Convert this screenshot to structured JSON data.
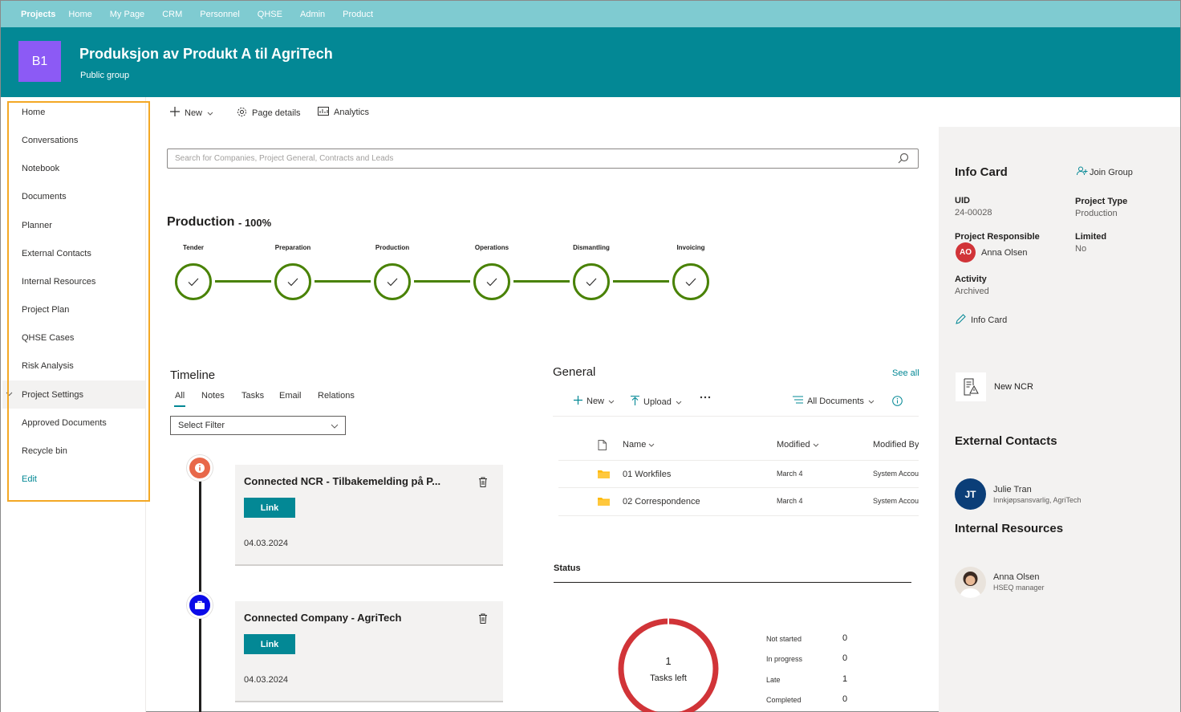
{
  "topnav": {
    "items": [
      "Projects",
      "Home",
      "My Page",
      "CRM",
      "Personnel",
      "QHSE",
      "Admin",
      "Product"
    ]
  },
  "header": {
    "logo_text": "B1",
    "title": "Produksjon av Produkt A til AgriTech",
    "subtitle": "Public group",
    "accent": "#038895"
  },
  "leftnav": {
    "items": [
      "Home",
      "Conversations",
      "Notebook",
      "Documents",
      "Planner",
      "External Contacts",
      "Internal Resources",
      "Project Plan",
      "QHSE Cases",
      "Risk Analysis",
      "Project Settings",
      "Approved Documents",
      "Recycle bin"
    ],
    "selected": "Project Settings",
    "edit_label": "Edit",
    "highlight_color": "#f3a825"
  },
  "commandbar": {
    "new_label": "New",
    "page_details_label": "Page details",
    "analytics_label": "Analytics"
  },
  "search": {
    "placeholder": "Search for Companies, Project General, Contracts and Leads"
  },
  "production": {
    "title": "Production",
    "percent": "- 100%",
    "stages": [
      "Tender",
      "Preparation",
      "Production",
      "Operations",
      "Dismantling",
      "Invoicing"
    ],
    "complete_color": "#498205"
  },
  "timeline": {
    "title": "Timeline",
    "tabs": [
      "All",
      "Notes",
      "Tasks",
      "Email",
      "Relations"
    ],
    "active_tab": "All",
    "filter_placeholder": "Select Filter",
    "cards": [
      {
        "title": "Connected NCR - Tilbakemelding på P...",
        "link_label": "Link",
        "date": "04.03.2024",
        "icon": "info-icon",
        "color": "#e8684a"
      },
      {
        "title": "Connected Company - AgriTech",
        "link_label": "Link",
        "date": "04.03.2024",
        "icon": "briefcase-icon",
        "color": "#0a0ae8"
      }
    ]
  },
  "general": {
    "title": "General",
    "see_all": "See all",
    "new_label": "New",
    "upload_label": "Upload",
    "view_label": "All Documents",
    "columns": [
      "Name",
      "Modified",
      "Modified By"
    ],
    "rows": [
      {
        "name": "01 Workfiles",
        "modified": "March 4",
        "modified_by": "System Account"
      },
      {
        "name": "02 Correspondence",
        "modified": "March 4",
        "modified_by": "System Account"
      }
    ]
  },
  "status": {
    "title": "Status",
    "tasks_left_count": "1",
    "tasks_left_label": "Tasks left",
    "rows": [
      {
        "label": "Not started",
        "value": "0"
      },
      {
        "label": "In progress",
        "value": "0"
      },
      {
        "label": "Late",
        "value": "1"
      },
      {
        "label": "Completed",
        "value": "0"
      }
    ],
    "ring_color": "#d13438"
  },
  "infocard": {
    "title": "Info Card",
    "join_label": "Join Group",
    "uid_label": "UID",
    "uid_value": "24-00028",
    "type_label": "Project Type",
    "type_value": "Production",
    "responsible_label": "Project Responsible",
    "responsible_initials": "AO",
    "responsible_name": "Anna Olsen",
    "limited_label": "Limited",
    "limited_value": "No",
    "activity_label": "Activity",
    "activity_value": "Archived",
    "edit_label": "Info Card",
    "new_ncr_label": "New NCR",
    "external_title": "External Contacts",
    "external_initials": "JT",
    "external_name": "Julie Tran",
    "external_role": "Innkjøpsansvarlig, AgriTech",
    "internal_title": "Internal Resources",
    "internal_name": "Anna Olsen",
    "internal_role": "HSEQ manager"
  }
}
